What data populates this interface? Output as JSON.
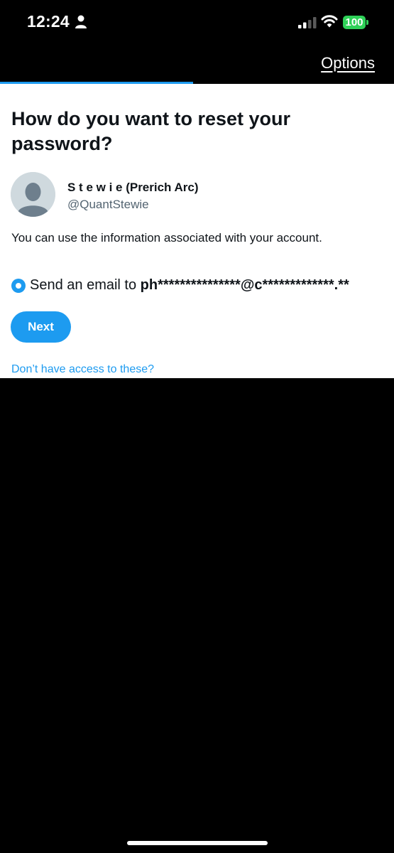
{
  "status_bar": {
    "time": "12:24",
    "battery_level": "100",
    "battery_color": "#2fd158"
  },
  "nav": {
    "options_label": "Options",
    "progress_fraction": 0.49
  },
  "main": {
    "title": "How do you want to reset your password?",
    "user": {
      "display_name": "S t e w i e (Prerich Arc)",
      "handle": "@QuantStewie",
      "avatar_icon": "default-avatar-icon"
    },
    "info_text": "You can use the information associated with your account.",
    "reset_option": {
      "label_prefix": "Send an email to ",
      "masked_email": "ph***************@c*************.**",
      "selected": true
    },
    "next_button": "Next",
    "no_access_link": "Don’t have access to these?"
  },
  "colors": {
    "accent": "#1d9bf0",
    "text_primary": "#0f1419",
    "text_secondary": "#536471"
  }
}
